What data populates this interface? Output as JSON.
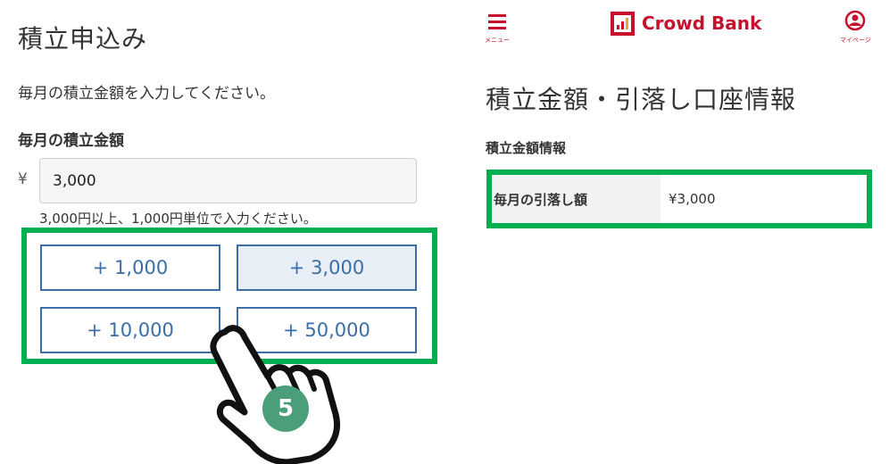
{
  "left": {
    "title": "積立申込み",
    "instruction": "毎月の積立金額を入力してください。",
    "section_label": "毎月の積立金額",
    "currency_symbol": "¥",
    "amount_value": "3,000",
    "hint": "3,000円以上、1,000円単位で入力ください。",
    "add_buttons": [
      "+ 1,000",
      "+ 3,000",
      "+ 10,000",
      "+ 50,000"
    ],
    "selected_button_index": 1,
    "step_number": "5"
  },
  "right": {
    "header": {
      "menu_label": "メニュー",
      "brand": "Crowd Bank",
      "mypage_label": "マイページ"
    },
    "title": "積立金額・引落し口座情報",
    "section_label": "積立金額情報",
    "row_label": "毎月の引落し額",
    "row_value": "¥3,000"
  },
  "colors": {
    "highlight": "#00b050",
    "button_border": "#3a6ea5",
    "brand_red": "#c8102e",
    "step_badge": "#4a9e7a"
  }
}
